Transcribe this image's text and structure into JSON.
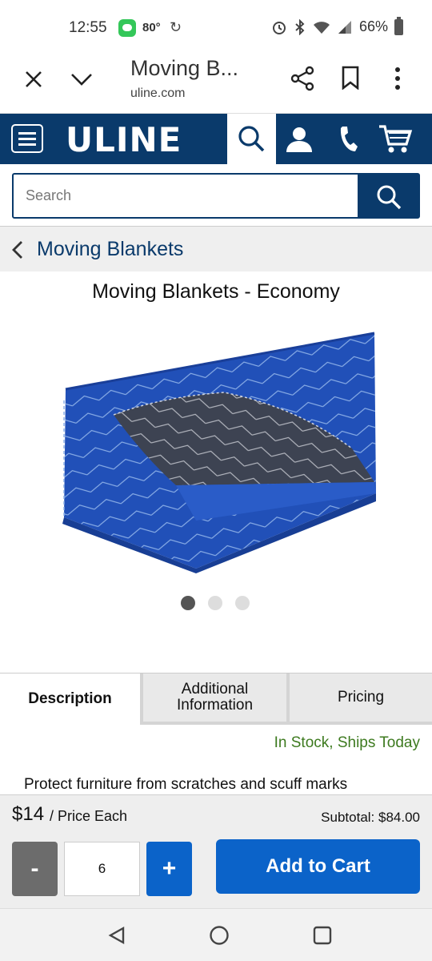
{
  "status_bar": {
    "time": "12:55",
    "temperature": "80°",
    "battery": "66%"
  },
  "browser": {
    "title": "Moving B...",
    "url": "uline.com"
  },
  "header": {
    "logo": "ULINE",
    "brand_color": "#0a3a6b"
  },
  "search": {
    "placeholder": "Search"
  },
  "breadcrumb": {
    "label": "Moving Blankets"
  },
  "product": {
    "title": "Moving Blankets - Economy",
    "image_icon": "moving-blanket-image",
    "carousel": {
      "total": 3,
      "active": 1
    }
  },
  "tabs": [
    {
      "label": "Description",
      "active": true
    },
    {
      "label_line1": "Additional",
      "label_line2": "Information",
      "active": false
    },
    {
      "label": "Pricing",
      "active": false
    }
  ],
  "stock": {
    "text": "In Stock, Ships Today",
    "color": "#3d7a1f"
  },
  "description": {
    "first_line": "Protect furniture from scratches and scuff marks"
  },
  "cart": {
    "price": "$14",
    "price_unit": "/ Price Each",
    "subtotal": "Subtotal: $84.00",
    "minus_label": "-",
    "quantity": "6",
    "plus_label": "+",
    "add_to_cart": "Add to Cart",
    "accent_color": "#0b63c9"
  }
}
